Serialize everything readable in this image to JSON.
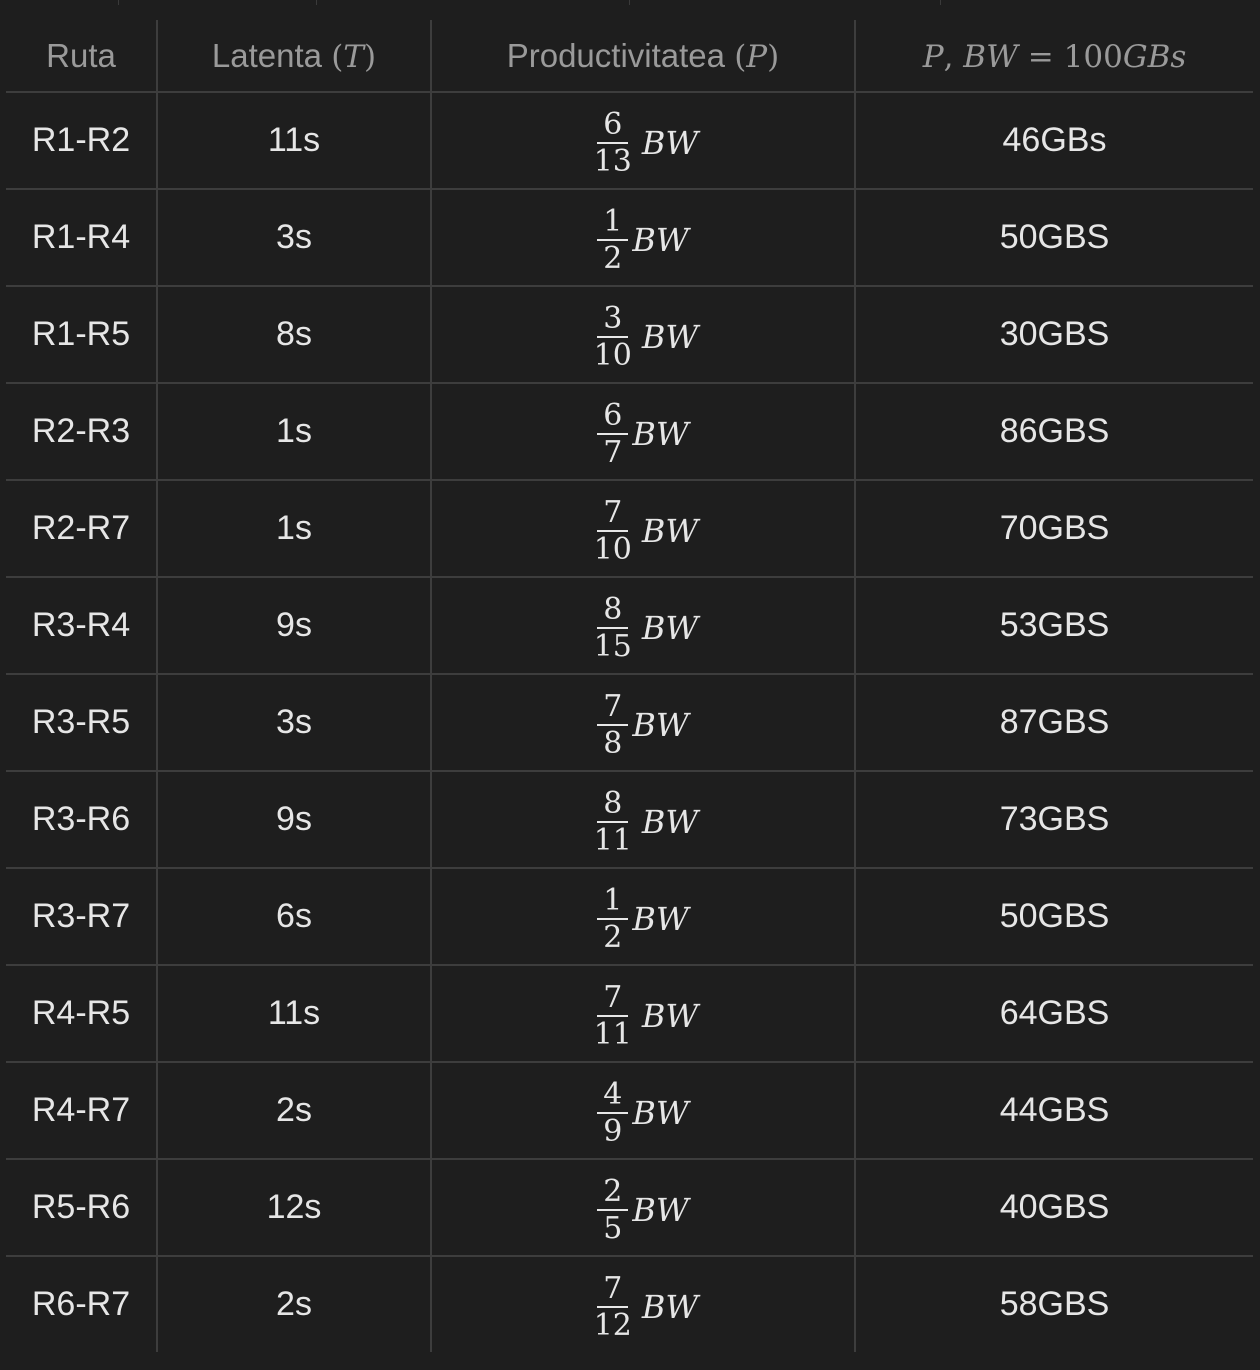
{
  "header": {
    "route": "Ruta",
    "latency_label": "Latenta",
    "latency_symbol": "T",
    "throughput_label": "Productivitatea",
    "throughput_symbol": "P",
    "calc_p": "P",
    "calc_bw": "BW",
    "calc_value": "100",
    "calc_unit_gb": "GB",
    "calc_unit_s": "s"
  },
  "unit_symbol": "BW",
  "rows": [
    {
      "route": "R1-R2",
      "latency": "11s",
      "num": "6",
      "den": "13",
      "value": "46GBs"
    },
    {
      "route": "R1-R4",
      "latency": "3s",
      "num": "1",
      "den": "2",
      "value": "50GBS"
    },
    {
      "route": "R1-R5",
      "latency": "8s",
      "num": "3",
      "den": "10",
      "value": "30GBS"
    },
    {
      "route": "R2-R3",
      "latency": "1s",
      "num": "6",
      "den": "7",
      "value": "86GBS"
    },
    {
      "route": "R2-R7",
      "latency": "1s",
      "num": "7",
      "den": "10",
      "value": "70GBS"
    },
    {
      "route": "R3-R4",
      "latency": "9s",
      "num": "8",
      "den": "15",
      "value": "53GBS"
    },
    {
      "route": "R3-R5",
      "latency": "3s",
      "num": "7",
      "den": "8",
      "value": "87GBS"
    },
    {
      "route": "R3-R6",
      "latency": "9s",
      "num": "8",
      "den": "11",
      "value": "73GBS"
    },
    {
      "route": "R3-R7",
      "latency": "6s",
      "num": "1",
      "den": "2",
      "value": "50GBS"
    },
    {
      "route": "R4-R5",
      "latency": "11s",
      "num": "7",
      "den": "11",
      "value": "64GBS"
    },
    {
      "route": "R4-R7",
      "latency": "2s",
      "num": "4",
      "den": "9",
      "value": "44GBS"
    },
    {
      "route": "R5-R6",
      "latency": "12s",
      "num": "2",
      "den": "5",
      "value": "40GBS"
    },
    {
      "route": "R6-R7",
      "latency": "2s",
      "num": "7",
      "den": "12",
      "value": "58GBS"
    }
  ]
}
